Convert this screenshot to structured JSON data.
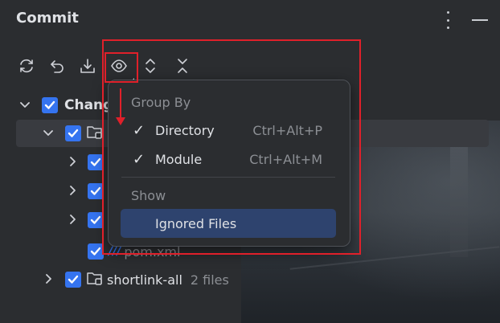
{
  "panel": {
    "title": "Commit"
  },
  "toolbar": {
    "buttons": [
      {
        "name": "refresh-icon"
      },
      {
        "name": "rollback-icon"
      },
      {
        "name": "shelve-icon"
      },
      {
        "name": "view-options-icon"
      },
      {
        "name": "expand-all-icon"
      },
      {
        "name": "collapse-all-icon"
      }
    ]
  },
  "tree": {
    "root_label": "Changes",
    "rows": [
      {
        "label": "",
        "name": "module-row"
      },
      {
        "label": ""
      },
      {
        "label": ""
      },
      {
        "label": ""
      },
      {
        "label": "pom.xml"
      },
      {
        "label": "shortlink-all",
        "count": "2 files"
      }
    ]
  },
  "popup": {
    "group_by_header": "Group By",
    "items": [
      {
        "label": "Directory",
        "shortcut": "Ctrl+Alt+P",
        "checked": true
      },
      {
        "label": "Module",
        "shortcut": "Ctrl+Alt+M",
        "checked": true
      }
    ],
    "show_header": "Show",
    "show_items": [
      {
        "label": "Ignored Files"
      }
    ]
  },
  "colors": {
    "accent": "#3574f0",
    "highlight": "#2e436e",
    "annotation": "#e0202a"
  }
}
